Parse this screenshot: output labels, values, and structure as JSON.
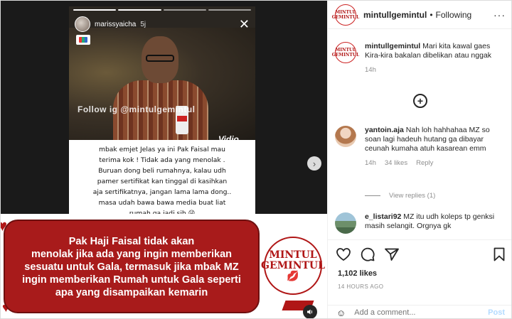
{
  "story": {
    "username": "marissyaicha",
    "time": "5j",
    "watermark": "Follow ig @mintulgemintul",
    "video_brand": "Vidio",
    "caption_lines": [
      "mbak emjet Jelas ya ini Pak Faisal mau",
      "terima kok ! Tidak ada yang menolak .",
      "Buruan dong beli rumahnya, kalau udh",
      "pamer sertifikat kan tinggal di kasihkan",
      "aja sertifikatnya, jangan lama lama dong..",
      "masa udah bawa bawa media buat liat",
      "rumah ga jadi sih 😜"
    ]
  },
  "banner": {
    "lines": [
      "Pak Haji Faisal tidak akan",
      "menolak jika ada yang ingin memberikan",
      "sesuatu untuk Gala, termasuk jika mbak MZ",
      "ingin memberikan Rumah untuk Gala seperti",
      "apa yang disampaikan kemarin"
    ],
    "logo_line1": "MINTUL",
    "logo_line2": "GEMINTUL"
  },
  "header": {
    "username": "mintullgemintul",
    "separator": "•",
    "follow_status": "Following",
    "more": "···",
    "avatar_text": "MINTUL GEMINTUL"
  },
  "caption": {
    "username": "mintullgemintul",
    "text": "Mari kita kawal gaes Kira-kira bakalan dibelikan atau nggak",
    "time": "14h"
  },
  "comments": [
    {
      "username": "yantoin.aja",
      "text": "Nah loh hahhahaa MZ so soan lagi hadeuh hutang ga dibayar ceunah kumaha atuh kasarean emm",
      "time": "14h",
      "likes": "34 likes",
      "reply": "Reply",
      "view_replies": "View replies (1)"
    },
    {
      "username": "e_listari92",
      "text": "MZ itu udh koleps tp genksi masih selangit. Orgnya gk"
    }
  ],
  "likes": "1,102 likes",
  "posted": "14 HOURS AGO",
  "add_comment": {
    "placeholder": "Add a comment...",
    "post_label": "Post"
  },
  "colors": {
    "brand_red": "#a81b1b",
    "post_disabled": "#b3dbff",
    "muted": "#8e8e8e"
  },
  "icons": [
    "close-icon",
    "chevron-right-icon",
    "more-icon",
    "add-circle-icon",
    "heart-icon",
    "comment-icon",
    "share-icon",
    "save-icon",
    "emoji-icon",
    "volume-icon"
  ]
}
